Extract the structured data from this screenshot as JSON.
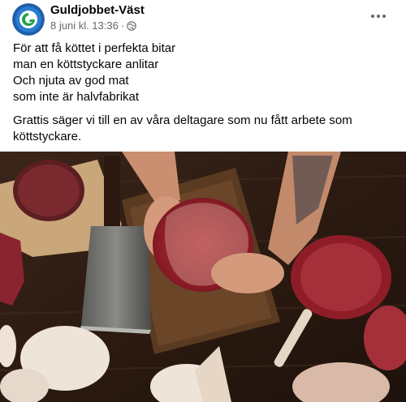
{
  "post": {
    "page_name": "Guldjobbet-Väst",
    "timestamp": "8 juni kl. 13:36",
    "separator": "·",
    "privacy_icon": "globe-icon",
    "more_icon": "more-options-icon",
    "avatar_icon": "guldjobbet-logo",
    "text_lines": [
      "För att få köttet i perfekta bitar",
      "man en köttstyckare anlitar",
      "Och njuta av god mat",
      "som inte är halvfabrikat"
    ],
    "text_para2_lines": [
      "Grattis säger vi till en av våra deltagare som nu fått arbete som",
      "köttstyckare."
    ],
    "image_subject": "butcher cutting meat with cleaver on wooden table"
  }
}
